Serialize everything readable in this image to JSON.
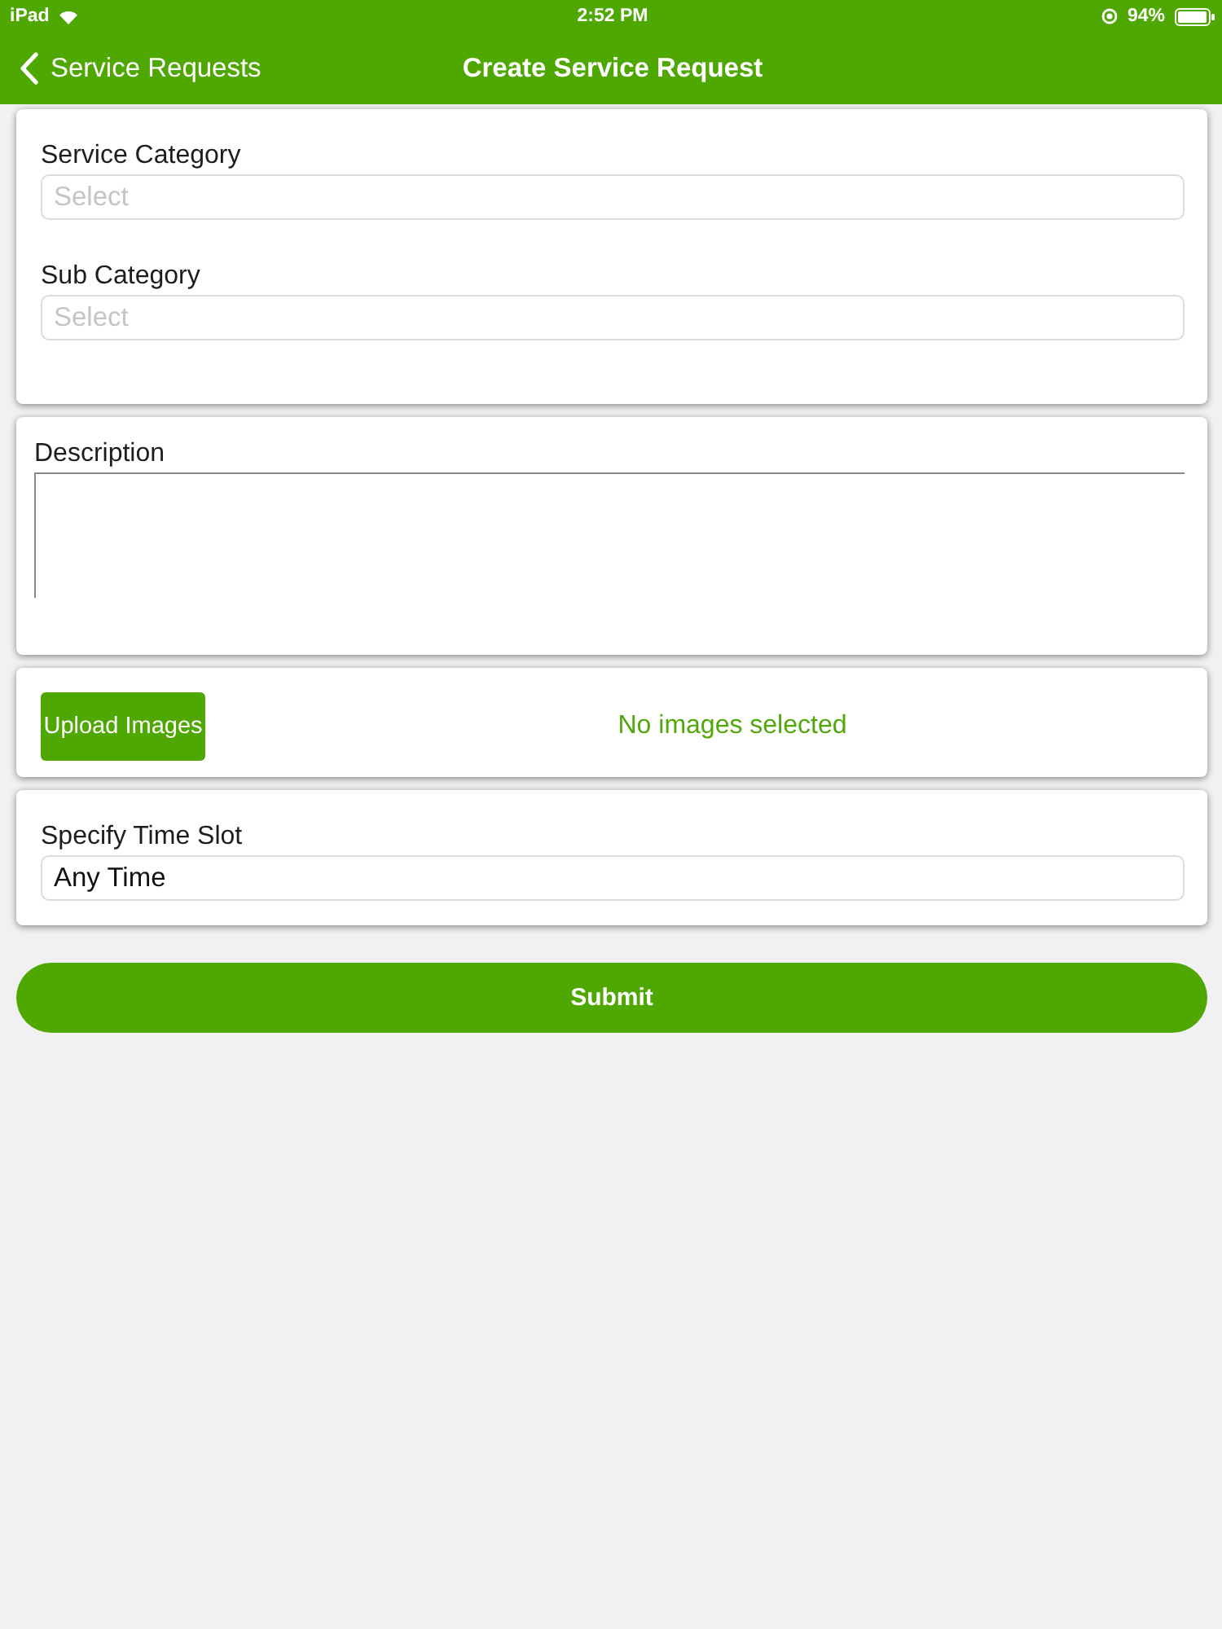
{
  "status_bar": {
    "device": "iPad",
    "time": "2:52 PM",
    "battery": "94%"
  },
  "nav_bar": {
    "back": "Service Requests",
    "title": "Create Service Request"
  },
  "sections": [
    {
      "kind": "fields",
      "fields": [
        {
          "kind": "select",
          "label": "Service Category",
          "placeholder": "Select"
        },
        {
          "kind": "select",
          "label": "Sub Category",
          "placeholder": "Select"
        }
      ]
    },
    {
      "kind": "fields",
      "fields": [
        {
          "kind": "textarea",
          "label": "Description"
        }
      ]
    },
    {
      "kind": "upload",
      "button": "Upload Images",
      "status": "No images selected"
    },
    {
      "kind": "fields",
      "fields": [
        {
          "kind": "input",
          "label": "Specify Time Slot",
          "value": "Any Time"
        }
      ]
    }
  ],
  "submit": "Submit"
}
